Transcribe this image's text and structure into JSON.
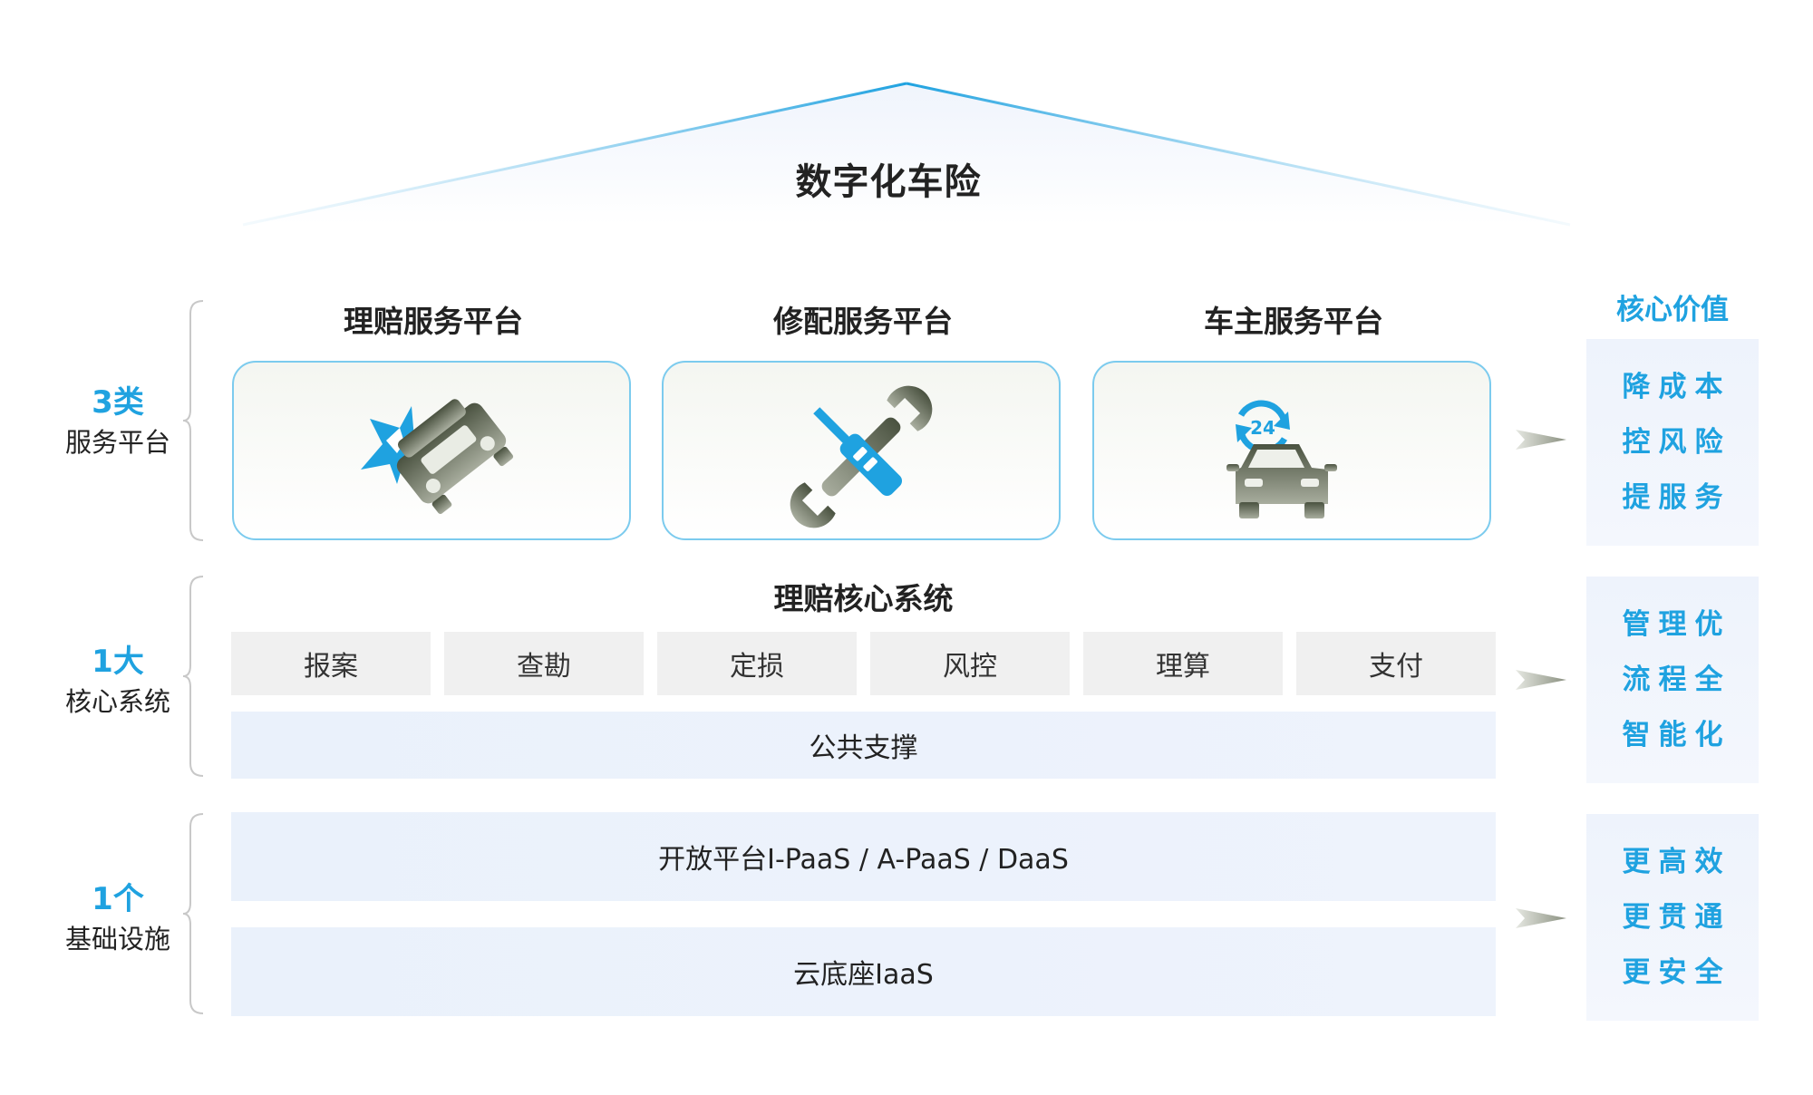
{
  "title": "数字化车险",
  "rows": [
    {
      "num": "3类",
      "text": "服务平台"
    },
    {
      "num": "1大",
      "text": "核心系统"
    },
    {
      "num": "1个",
      "text": "基础设施"
    }
  ],
  "platforms": [
    {
      "title": "理赔服务平台",
      "icon": "car-crash-icon"
    },
    {
      "title": "修配服务平台",
      "icon": "wrench-screwdriver-icon"
    },
    {
      "title": "车主服务平台",
      "icon": "car-24h-service-icon"
    }
  ],
  "core": {
    "title": "理赔核心系统",
    "modules": [
      "报案",
      "查勘",
      "定损",
      "风控",
      "理算",
      "支付"
    ],
    "support": "公共支撑"
  },
  "infra": {
    "open_platform": "开放平台I-PaaS / A-PaaS / DaaS",
    "cloud": "云底座IaaS"
  },
  "value": {
    "title": "核心价值",
    "groups": [
      [
        "降成本",
        "控风险",
        "提服务"
      ],
      [
        "管理优",
        "流程全",
        "智能化"
      ],
      [
        "更高效",
        "更贯通",
        "更安全"
      ]
    ]
  },
  "colors": {
    "accent": "#1fa2e0",
    "icon_gray": "#6e7564",
    "card_border": "#7ccbee",
    "panel_bg": "#eef3fc",
    "module_bg": "#f0f0f0"
  }
}
